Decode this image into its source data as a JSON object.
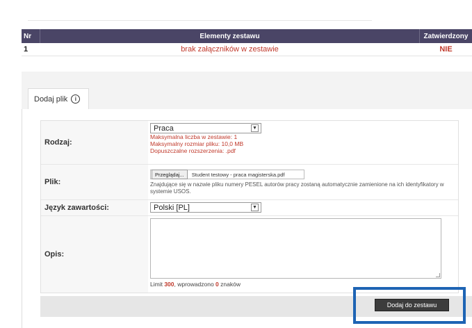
{
  "items_table": {
    "headers": {
      "nr": "Nr",
      "elements": "Elementy zestawu",
      "approved": "Zatwierdzony"
    },
    "rows": [
      {
        "nr": "1",
        "element": "brak załączników w zestawie",
        "approved": "NIE"
      }
    ]
  },
  "tab": {
    "label": "Dodaj plik",
    "info_icon": "info-icon"
  },
  "form": {
    "type": {
      "label": "Rodzaj:",
      "value": "Praca",
      "hints": [
        "Maksymalna liczba w zestawie: 1",
        "Maksymalny rozmiar pliku: 10,0 MB",
        "Dopuszczalne rozszerzenia: .pdf"
      ]
    },
    "file": {
      "label": "Plik:",
      "browse_label": "Przeglądaj...",
      "filename": "Student testowy - praca magisterska.pdf",
      "note": "Znajdujące się w nazwie pliku numery PESEL autorów pracy zostaną automatycznie zamienione na ich identyfikatory w systemie USOS."
    },
    "language": {
      "label": "Język zawartości:",
      "value": "Polski [PL]"
    },
    "description": {
      "label": "Opis:",
      "value": "",
      "limit_prefix": "Limit ",
      "limit_value": "300",
      "limit_middle": ", wprowadzono ",
      "entered_value": "0",
      "limit_suffix": " znaków"
    }
  },
  "actions": {
    "submit_label": "Dodaj do zestawu"
  },
  "colors": {
    "header_bg": "#4a4566",
    "error_red": "#c0392b",
    "highlight": "#1e64b4",
    "button_bg": "#3c3c3c"
  }
}
